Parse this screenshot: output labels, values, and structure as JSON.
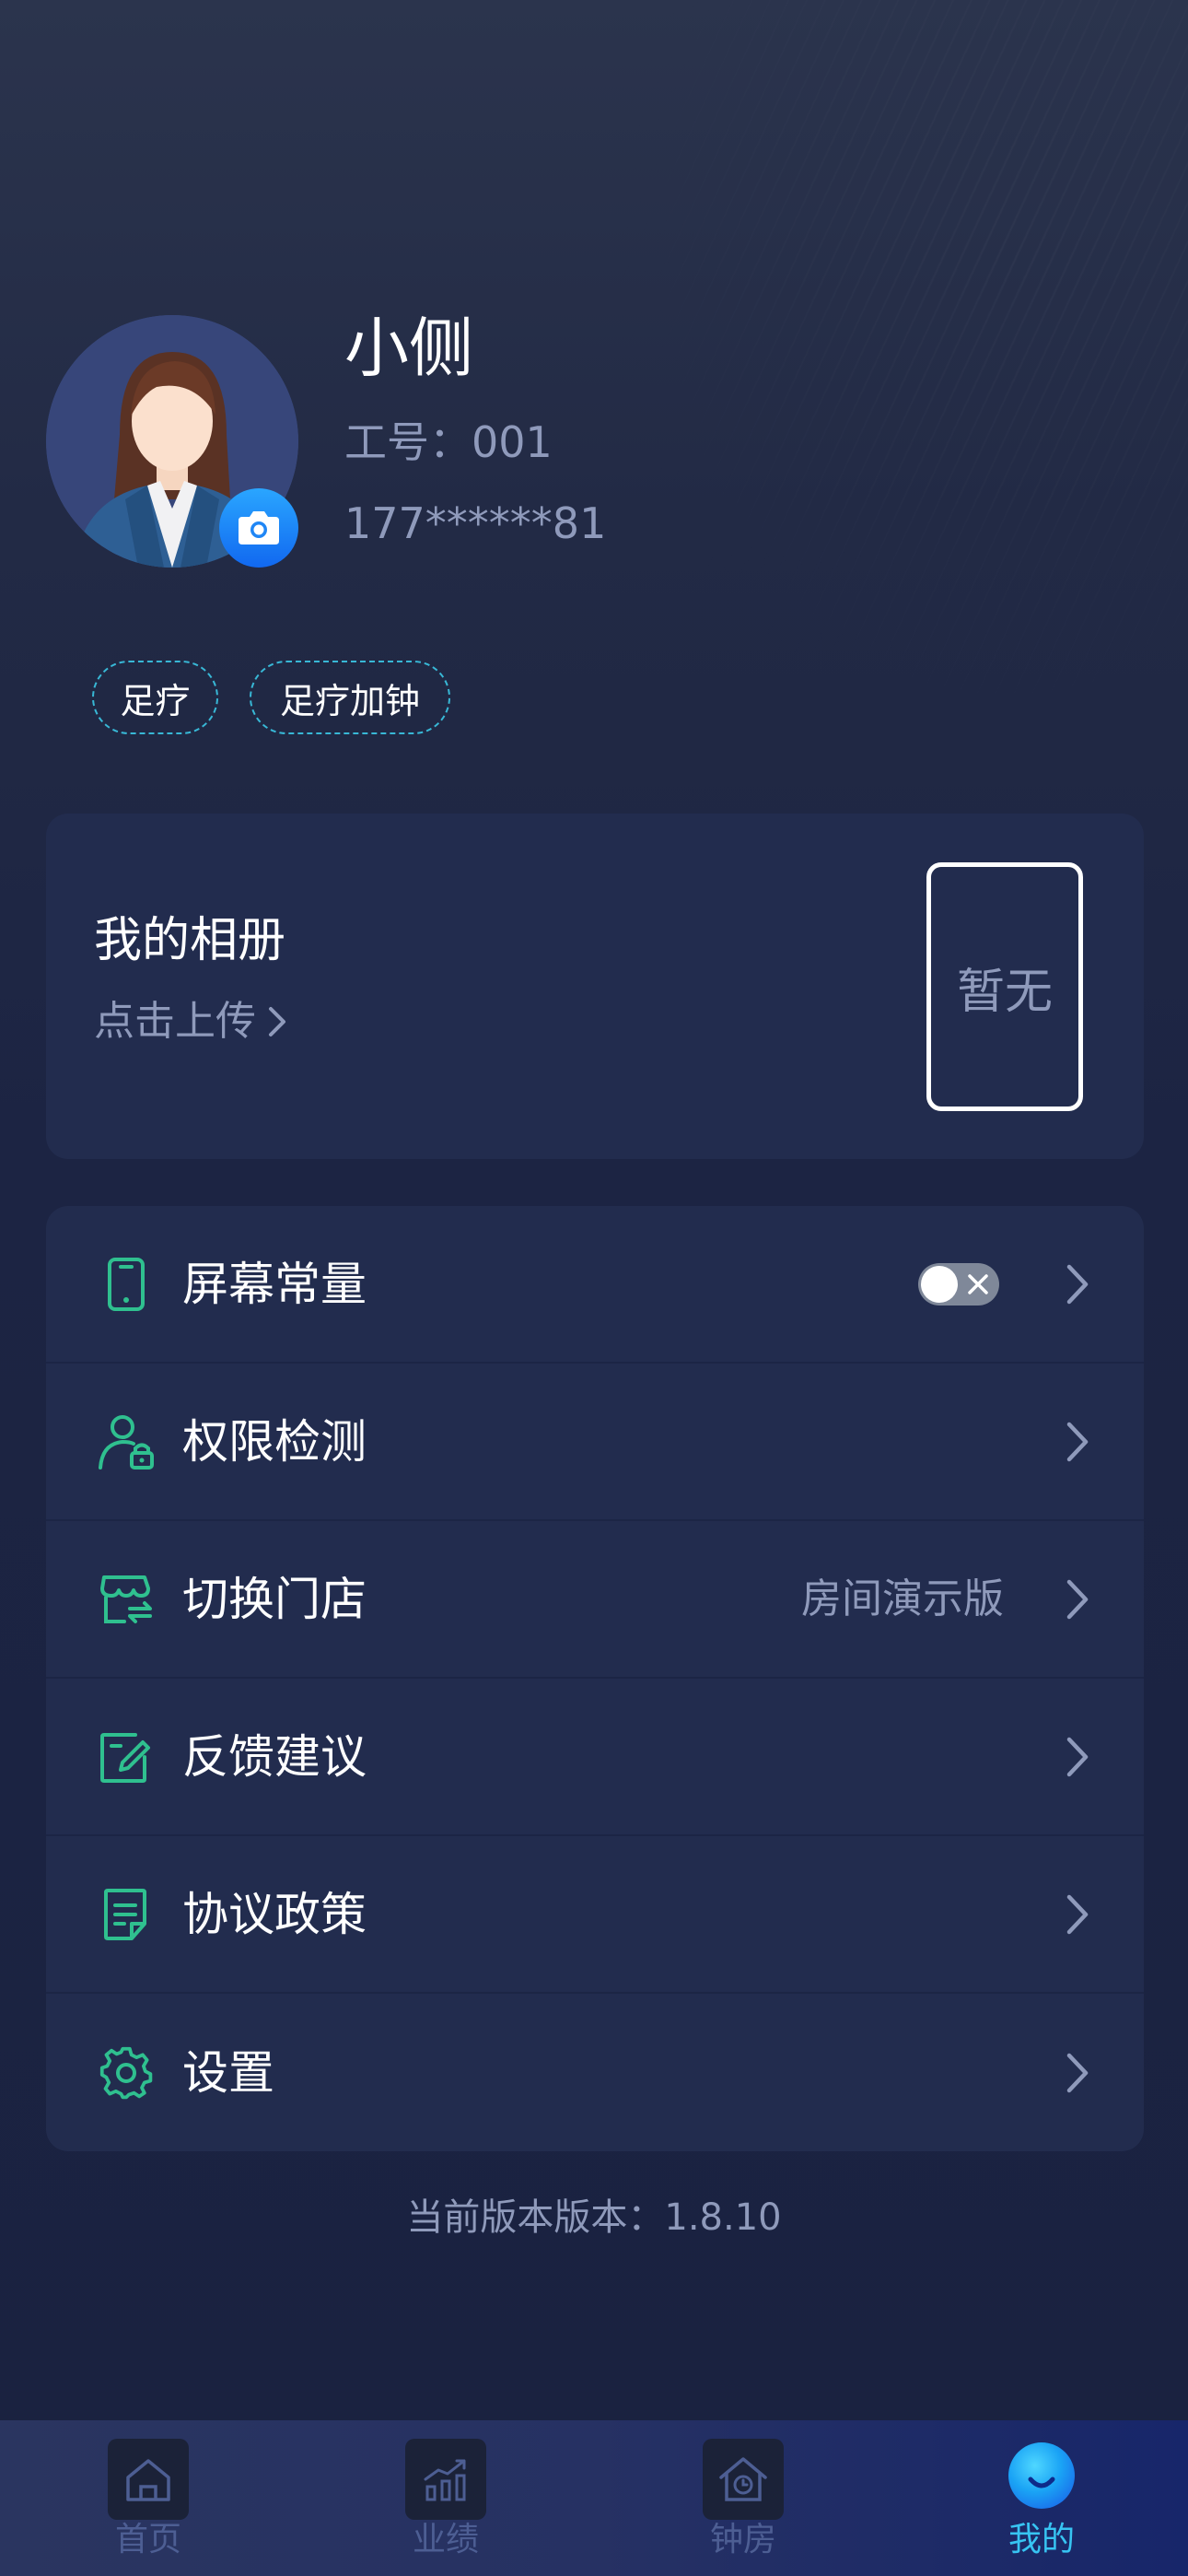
{
  "profile": {
    "name": "小侧",
    "employee_id": "工号：001",
    "phone": "177******81",
    "tags": [
      "足疗",
      "足疗加钟"
    ]
  },
  "album": {
    "title": "我的相册",
    "upload_label": "点击上传",
    "placeholder": "暂无"
  },
  "menu": {
    "items": [
      {
        "label": "屏幕常量",
        "icon": "phone-icon",
        "toggle": "off"
      },
      {
        "label": "权限检测",
        "icon": "user-lock-icon"
      },
      {
        "label": "切换门店",
        "icon": "store-switch-icon",
        "value": "房间演示版"
      },
      {
        "label": "反馈建议",
        "icon": "edit-note-icon"
      },
      {
        "label": "协议政策",
        "icon": "document-icon"
      },
      {
        "label": "设置",
        "icon": "gear-icon"
      }
    ]
  },
  "version_text": "当前版本版本：1.8.10",
  "tabbar": {
    "tabs": [
      {
        "label": "首页",
        "icon": "home-icon",
        "active": false
      },
      {
        "label": "业绩",
        "icon": "chart-icon",
        "active": false
      },
      {
        "label": "钟房",
        "icon": "clock-house-icon",
        "active": false
      },
      {
        "label": "我的",
        "icon": "profile-smile-icon",
        "active": true
      }
    ]
  },
  "colors": {
    "accent": "#37c4f2",
    "icon_green": "#2fc08f",
    "muted_text": "#8f9abb",
    "card_bg": "#222c4e"
  }
}
